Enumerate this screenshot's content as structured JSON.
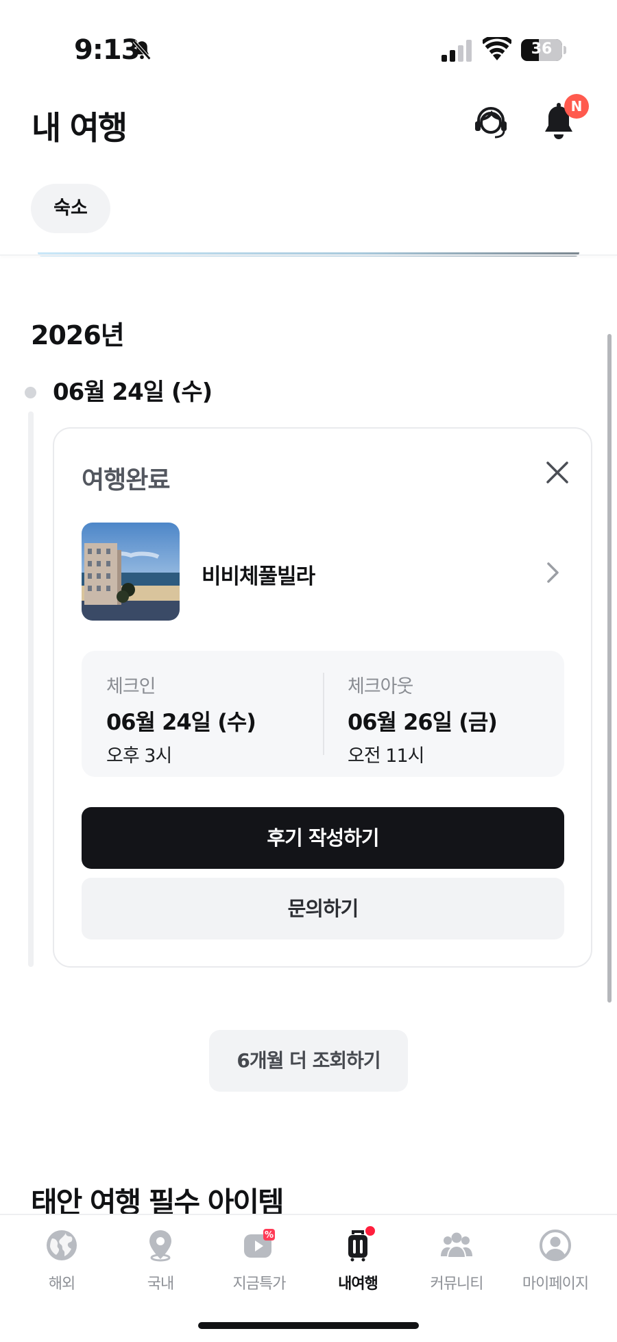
{
  "status_bar": {
    "time": "9:13",
    "battery": "36"
  },
  "header": {
    "title": "내 여행",
    "notification_badge": "N"
  },
  "filter": {
    "chip_label": "숙소"
  },
  "timeline": {
    "year": "2026년",
    "date": "06월 24일 (수)",
    "card": {
      "status": "여행완료",
      "stay_name": "비비체풀빌라",
      "checkin": {
        "label": "체크인",
        "date": "06월 24일 (수)",
        "time": "오후 3시"
      },
      "checkout": {
        "label": "체크아웃",
        "date": "06월 26일 (금)",
        "time": "오전 11시"
      },
      "review_button": "후기 작성하기",
      "inquiry_button": "문의하기"
    }
  },
  "load_more_button": "6개월 더 조회하기",
  "section_heading": "태안 여행 필수 아이템",
  "bottom_nav": {
    "items": [
      {
        "label": "해외",
        "icon": "globe-icon"
      },
      {
        "label": "국내",
        "icon": "map-pin-icon"
      },
      {
        "label": "지금특가",
        "icon": "deal-play-icon"
      },
      {
        "label": "내여행",
        "icon": "luggage-icon"
      },
      {
        "label": "커뮤니티",
        "icon": "community-icon"
      },
      {
        "label": "마이페이지",
        "icon": "profile-icon"
      }
    ],
    "active_index": 3
  },
  "colors": {
    "badge": "#ff5a4e",
    "primary_button": "#131418",
    "nav_dot": "#ff1f3d"
  }
}
